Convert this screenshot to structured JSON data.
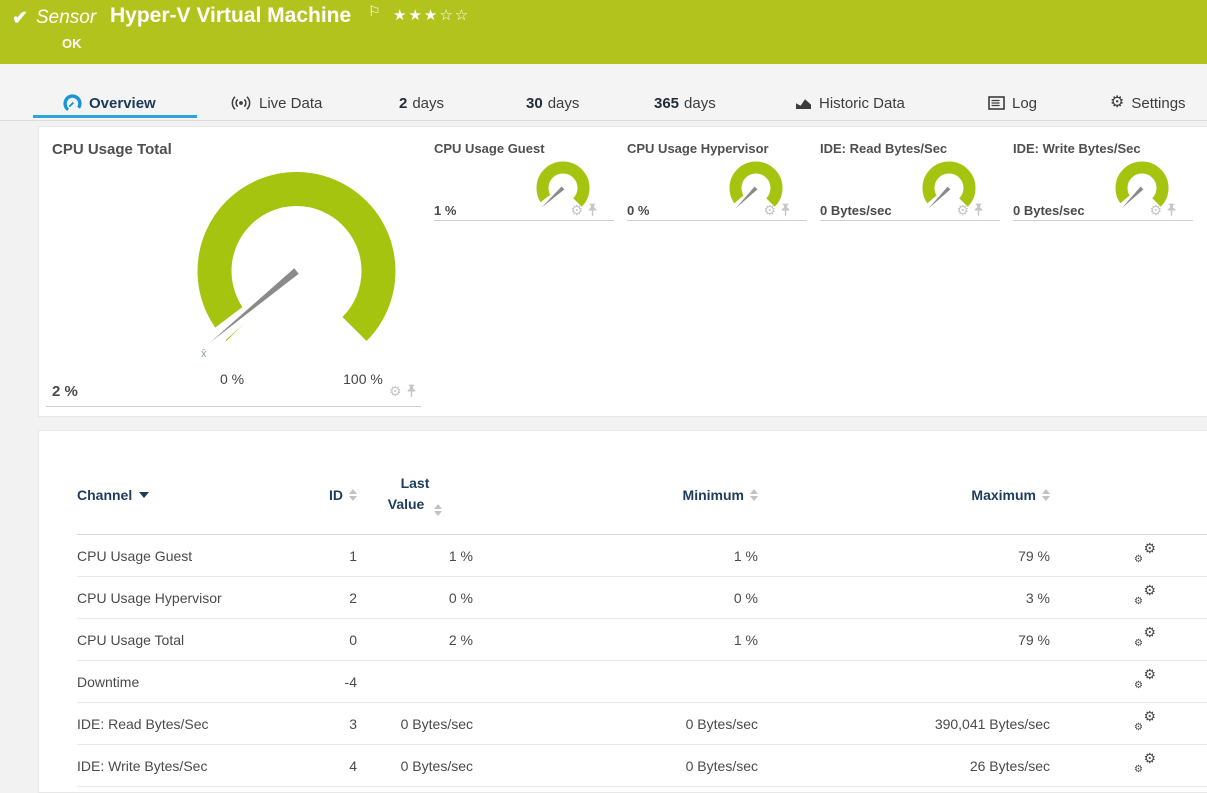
{
  "header": {
    "status_icon": "check",
    "kind": "Sensor",
    "title": "Hyper-V Virtual Machine",
    "status": "OK",
    "stars_filled": 3,
    "stars_total": 5,
    "bar_color": "#b3c31d"
  },
  "tabs": [
    {
      "label": "Overview",
      "icon": "gauge-icon",
      "active": true
    },
    {
      "label": "Live Data",
      "icon": "broadcast-icon",
      "active": false
    },
    {
      "prefix": "2",
      "suffix": "days",
      "active": false
    },
    {
      "prefix": "30",
      "suffix": "days",
      "active": false
    },
    {
      "prefix": "365",
      "suffix": "days",
      "active": false
    },
    {
      "label": "Historic Data",
      "icon": "area-chart-icon",
      "active": false
    },
    {
      "label": "Log",
      "icon": "log-icon",
      "active": false
    },
    {
      "label": "Settings",
      "icon": "gear-icon",
      "active": false
    }
  ],
  "accent": {
    "tab_underline": "#2aa5de",
    "gauge_green": "#a5c40f",
    "icon_blue": "#1795d5"
  },
  "main_gauge": {
    "title": "CPU Usage Total",
    "value": "2 %",
    "percent": 2,
    "min_label": "0 %",
    "max_label": "100 %",
    "avg_marker": "x̄"
  },
  "small_gauges": [
    {
      "title": "CPU Usage Guest",
      "value": "1 %",
      "percent": 1
    },
    {
      "title": "CPU Usage Hypervisor",
      "value": "0 %",
      "percent": 0
    },
    {
      "title": "IDE: Read Bytes/Sec",
      "value": "0 Bytes/sec",
      "percent": 0
    },
    {
      "title": "IDE: Write Bytes/Sec",
      "value": "0 Bytes/sec",
      "percent": 0
    }
  ],
  "chart_data": {
    "type": "gauge-set",
    "gauges": [
      {
        "title": "CPU Usage Total",
        "value": 2,
        "unit": "%",
        "range": [
          0,
          100
        ]
      },
      {
        "title": "CPU Usage Guest",
        "value": 1,
        "unit": "%"
      },
      {
        "title": "CPU Usage Hypervisor",
        "value": 0,
        "unit": "%"
      },
      {
        "title": "IDE: Read Bytes/Sec",
        "value": 0,
        "unit": "Bytes/sec"
      },
      {
        "title": "IDE: Write Bytes/Sec",
        "value": 0,
        "unit": "Bytes/sec"
      }
    ]
  },
  "channel_table": {
    "columns": [
      {
        "label": "Channel",
        "sort": "active-desc"
      },
      {
        "label": "ID",
        "sort": "both"
      },
      {
        "label": "Last Value",
        "sort": "both",
        "two_line": true
      },
      {
        "label": "Minimum",
        "sort": "both"
      },
      {
        "label": "Maximum",
        "sort": "both"
      }
    ],
    "rows": [
      {
        "channel": "CPU Usage Guest",
        "id": "1",
        "last": "1 %",
        "min": "1 %",
        "max": "79 %"
      },
      {
        "channel": "CPU Usage Hypervisor",
        "id": "2",
        "last": "0 %",
        "min": "0 %",
        "max": "3 %"
      },
      {
        "channel": "CPU Usage Total",
        "id": "0",
        "last": "2 %",
        "min": "1 %",
        "max": "79 %"
      },
      {
        "channel": "Downtime",
        "id": "-4",
        "last": "",
        "min": "",
        "max": ""
      },
      {
        "channel": "IDE: Read Bytes/Sec",
        "id": "3",
        "last": "0 Bytes/sec",
        "min": "0 Bytes/sec",
        "max": "390,041 Bytes/sec"
      },
      {
        "channel": "IDE: Write Bytes/Sec",
        "id": "4",
        "last": "0 Bytes/sec",
        "min": "0 Bytes/sec",
        "max": "26 Bytes/sec"
      }
    ]
  }
}
